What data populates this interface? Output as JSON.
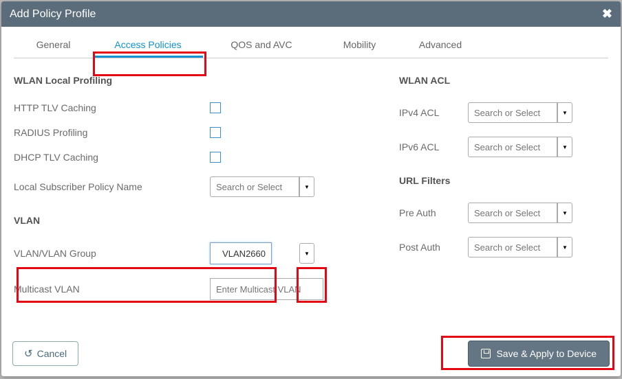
{
  "dialog": {
    "title": "Add Policy Profile",
    "close": "✖"
  },
  "tabs": {
    "general": "General",
    "access": "Access Policies",
    "qos": "QOS and AVC",
    "mobility": "Mobility",
    "advanced": "Advanced"
  },
  "left": {
    "section_wlan_local": "WLAN Local Profiling",
    "http_tlv": "HTTP TLV Caching",
    "radius_profiling": "RADIUS Profiling",
    "dhcp_tlv": "DHCP TLV Caching",
    "local_sub_policy": "Local Subscriber Policy Name",
    "local_sub_placeholder": "Search or Select",
    "section_vlan": "VLAN",
    "vlan_group": "VLAN/VLAN Group",
    "vlan_group_value": "VLAN2660",
    "multicast_vlan": "Multicast VLAN",
    "multicast_placeholder": "Enter Multicast VLAN"
  },
  "right": {
    "section_wlan_acl": "WLAN ACL",
    "ipv4_acl": "IPv4 ACL",
    "ipv6_acl": "IPv6 ACL",
    "section_url": "URL Filters",
    "pre_auth": "Pre Auth",
    "post_auth": "Post Auth",
    "combo_placeholder": "Search or Select"
  },
  "footer": {
    "cancel": "Cancel",
    "save": "Save & Apply to Device"
  }
}
